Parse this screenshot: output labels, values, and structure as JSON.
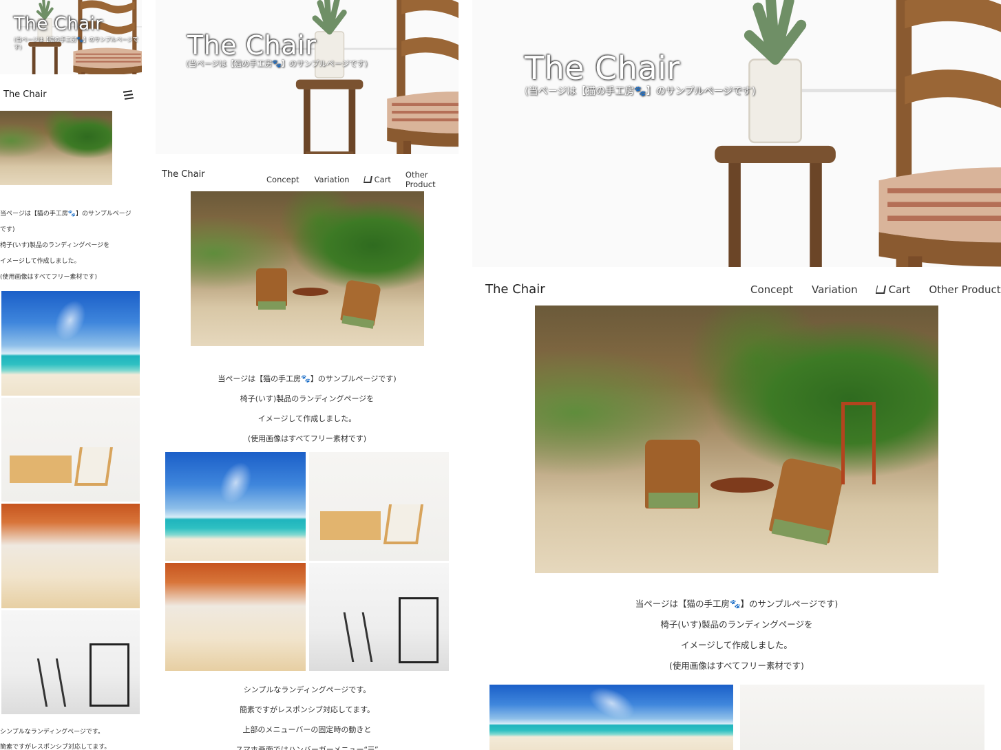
{
  "site": {
    "hero_title": "The Chair",
    "hero_subtitle": "(当ページは【猫の手工房🐾】のサンプルページです)",
    "brand": "The Chair"
  },
  "nav": {
    "concept": "Concept",
    "variation": "Variation",
    "cart": "Cart",
    "other": "Other Product",
    "menu_icon": "hamburger-icon",
    "cart_icon": "cart-icon"
  },
  "intro": {
    "line1": "当ページは【猫の手工房🐾】のサンプルページです)",
    "line2": "椅子(いす)製品のランディングページを",
    "line3": "イメージして作成しました。",
    "line4": "(使用画像はすべてフリー素材です)"
  },
  "mobile_intro": {
    "line1a": "当ページは【猫の手工房🐾】のサンプルページ",
    "line1b": "です)"
  },
  "outro": {
    "line1": "シンプルなランディングページです。",
    "line2": "簡素ですがレスポンシブ対応してます。",
    "line3": "上部のメニューバーの固定時の動きと",
    "line4": "スマホ画面ではハンバーガーメニュー“☰”"
  },
  "colors": {
    "text": "#222222",
    "background": "#ffffff"
  }
}
